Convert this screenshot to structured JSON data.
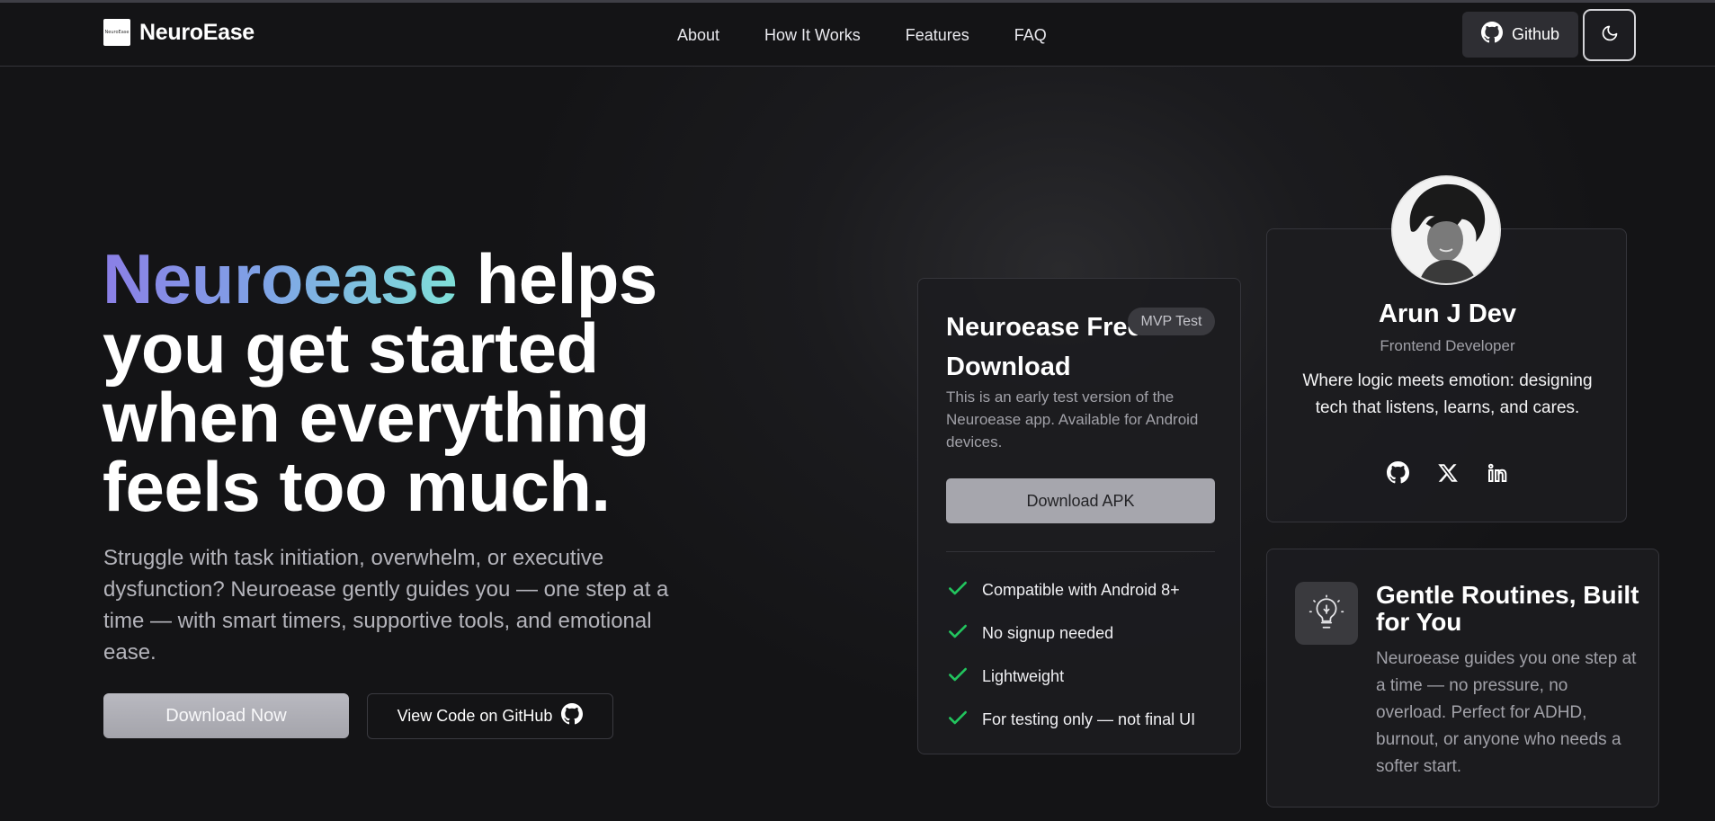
{
  "nav": {
    "brand": "NeuroEase",
    "logo_text": "NeuroEase",
    "links": [
      "About",
      "How It Works",
      "Features",
      "FAQ"
    ],
    "github_label": "Github",
    "theme_toggle_icon": "moon-icon"
  },
  "hero": {
    "title_highlight": "Neuroease",
    "title_rest": " helps you get started when everything feels too much.",
    "subtitle": "Struggle with task initiation, overwhelm, or executive dysfunction? Neuroease gently guides you — one step at a time — with smart timers, supportive tools, and emotional ease.",
    "primary_button": "Download Now",
    "secondary_button": "View Code on GitHub"
  },
  "download_card": {
    "title": "Neuroease Free Download",
    "badge": "MVP Test",
    "description": "This is an early test version of the Neuroease app. Available for Android devices.",
    "button": "Download APK",
    "features": [
      "Compatible with Android 8+",
      "No signup needed",
      "Lightweight",
      "For testing only — not final UI"
    ],
    "check_color": "#22c55e"
  },
  "profile": {
    "name": "Arun J Dev",
    "role": "Frontend Developer",
    "bio": "Where logic meets emotion: designing tech that listens, learns, and cares.",
    "socials": [
      "github-icon",
      "x-icon",
      "linkedin-icon"
    ]
  },
  "feature_card": {
    "icon": "lightbulb-icon",
    "title": "Gentle Routines, Built for You",
    "description": "Neuroease guides you one step at a time — no pressure, no overload. Perfect for ADHD, burnout, or anyone who needs a softer start."
  },
  "colors": {
    "background": "#141416",
    "gradient_start": "#8b7fe6",
    "gradient_end": "#7fe0d8",
    "muted_text": "#a1a1a8"
  }
}
